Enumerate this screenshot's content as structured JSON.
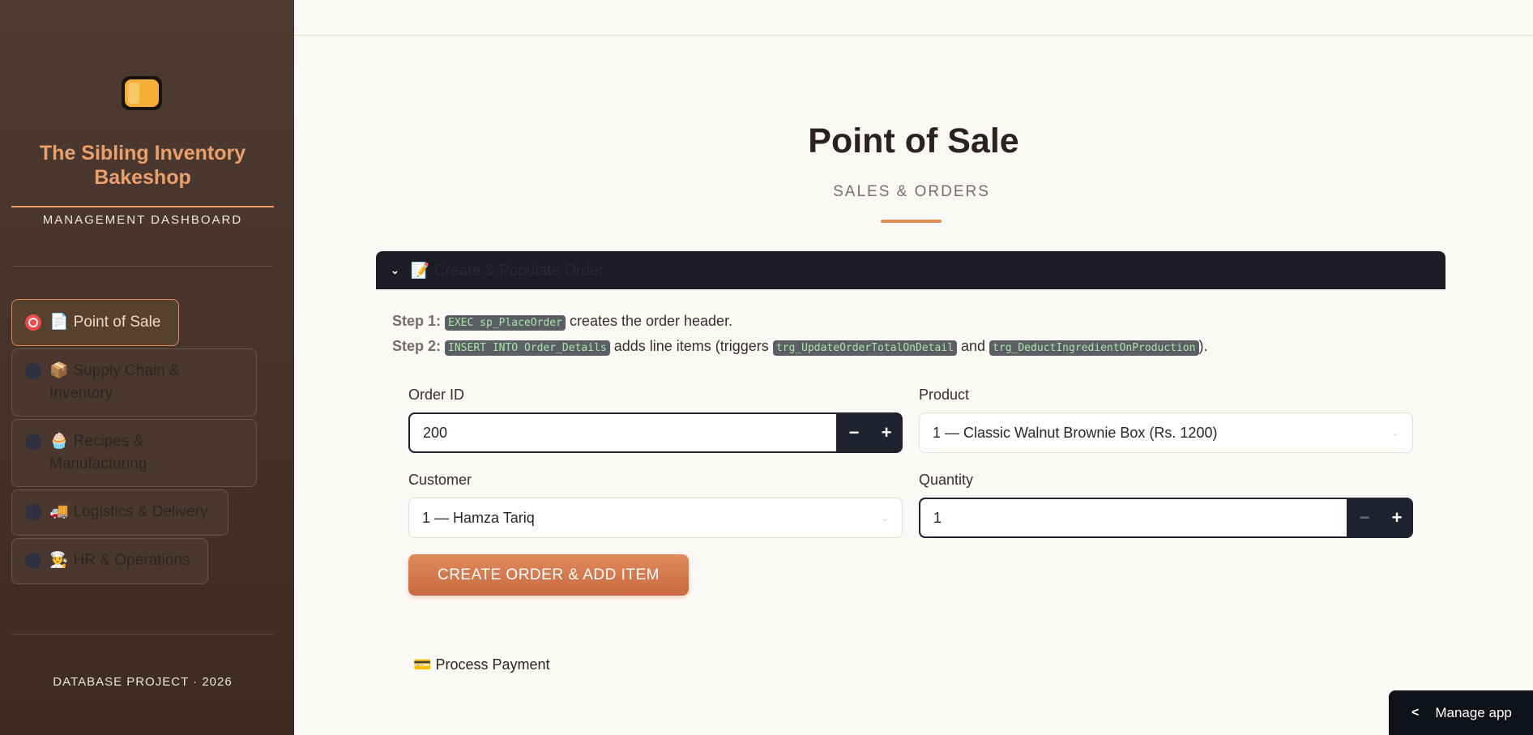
{
  "sidebar": {
    "logo_icon": "bread-icon",
    "brand": "The Sibling Inventory Bakeshop",
    "subtitle": "MANAGEMENT DASHBOARD",
    "nav": [
      {
        "icon": "📄",
        "label": "Point of Sale",
        "active": true
      },
      {
        "icon": "📦",
        "label": "Supply Chain & Inventory"
      },
      {
        "icon": "🧁",
        "label": "Recipes & Manufacturing"
      },
      {
        "icon": "🚚",
        "label": "Logistics & Delivery"
      },
      {
        "icon": "🧑‍🍳",
        "label": "HR & Operations"
      }
    ],
    "footer": "DATABASE PROJECT · 2026"
  },
  "main": {
    "title": "Point of Sale",
    "subtitle": "SALES & ORDERS",
    "expander": {
      "icon": "📝",
      "label": "Create & Populate Order"
    },
    "steps": {
      "step1_label": "Step 1:",
      "step1_code": "EXEC sp_PlaceOrder",
      "step1_text": "creates the order header.",
      "step2_label": "Step 2:",
      "step2_code": "INSERT INTO Order_Details",
      "step2_text_a": "adds line items (triggers",
      "step2_code_b": "trg_UpdateOrderTotalOnDetail",
      "step2_text_b": "and",
      "step2_code_c": "trg_DeductIngredientOnProduction",
      "step2_text_c": ")."
    },
    "form": {
      "order_id_label": "Order ID",
      "order_id_value": "200",
      "product_label": "Product",
      "product_value": "1 — Classic Walnut Brownie Box (Rs. 1200)",
      "customer_label": "Customer",
      "customer_value": "1 — Hamza Tariq",
      "quantity_label": "Quantity",
      "quantity_value": "1",
      "minus": "−",
      "plus": "+"
    },
    "cta": "CREATE ORDER & ADD ITEM",
    "payment": {
      "icon": "💳",
      "label": "Process Payment"
    }
  },
  "manage_app": "Manage app",
  "colors": {
    "accent": "#e08a4f",
    "sidebar_bg": "#4e3a31",
    "active_radio": "#ef4a4a"
  }
}
